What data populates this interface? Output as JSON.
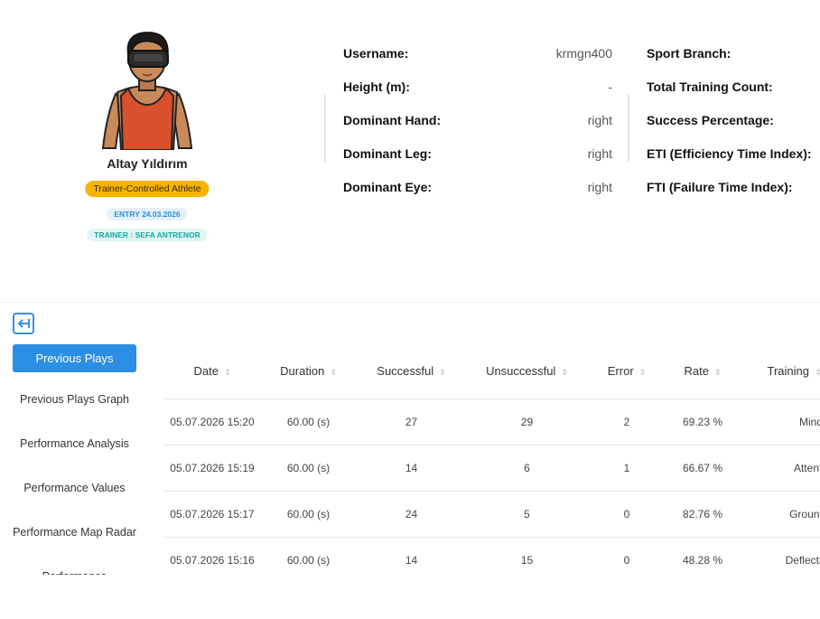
{
  "profile": {
    "name": "Altay Yıldırım",
    "type_badge": "Trainer-Controlled Athlete",
    "entry_badge": "ENTRY 24.03.2026",
    "trainer_badge": "TRAINER : SEFA ANTRENOR",
    "info_left": [
      {
        "label": "Username:",
        "value": "krmgn400"
      },
      {
        "label": "Height (m):",
        "value": "-"
      },
      {
        "label": "Dominant Hand:",
        "value": "right"
      },
      {
        "label": "Dominant Leg:",
        "value": "right"
      },
      {
        "label": "Dominant Eye:",
        "value": "right"
      }
    ],
    "info_right": [
      {
        "label": "Sport Branch:"
      },
      {
        "label": "Total Training Count:"
      },
      {
        "label": "Success Percentage:"
      },
      {
        "label": "ETI (Efficiency Time Index):"
      },
      {
        "label": "FTI (Failure Time Index):"
      }
    ]
  },
  "collapse_icon": "arrow-left-icon",
  "menu": [
    {
      "label": "Previous Plays",
      "active": true
    },
    {
      "label": "Previous Plays Graph",
      "active": false
    },
    {
      "label": "Performance Analysis",
      "active": false
    },
    {
      "label": "Performance Values",
      "active": false
    },
    {
      "label": "Performance Map Radar",
      "active": false
    },
    {
      "label": "Performance",
      "active": false
    }
  ],
  "table": {
    "columns": [
      "Date",
      "Duration",
      "Successful",
      "Unsuccessful",
      "Error",
      "Rate",
      "Training"
    ],
    "rows": [
      [
        "05.07.2026 15:20",
        "60.00 (s)",
        "27",
        "29",
        "2",
        "69.23 %",
        "Mind Filter"
      ],
      [
        "05.07.2026 15:19",
        "60.00 (s)",
        "14",
        "6",
        "1",
        "66.67 %",
        "Attention W"
      ],
      [
        "05.07.2026 15:17",
        "60.00 (s)",
        "24",
        "5",
        "0",
        "82.76 %",
        "Ground Wav"
      ],
      [
        "05.07.2026 15:16",
        "60.00 (s)",
        "14",
        "15",
        "0",
        "48.28 %",
        "Deflection Po"
      ]
    ]
  },
  "colors": {
    "accent": "#2c8fe6",
    "badge_yellow": "#f5b400",
    "shirt": "#d9512c"
  }
}
